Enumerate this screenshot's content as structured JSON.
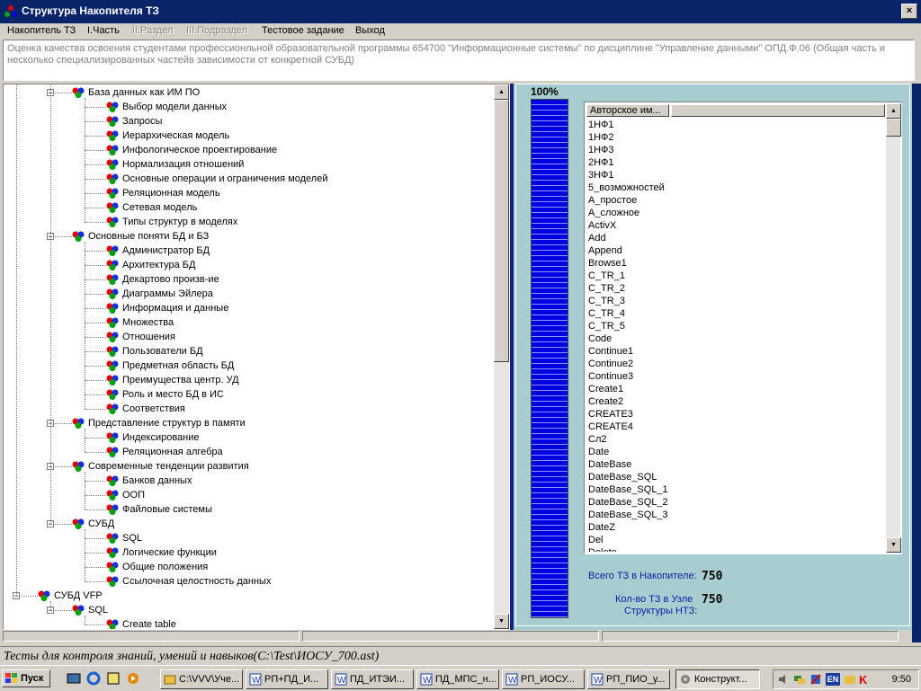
{
  "window": {
    "title": "Структура Накопителя ТЗ",
    "close_glyph": "×"
  },
  "menu": [
    {
      "label": "Накопитель ТЗ",
      "enabled": true
    },
    {
      "label": "I.Часть",
      "enabled": true
    },
    {
      "label": "II.Раздел",
      "enabled": false
    },
    {
      "label": "III.Подраздел",
      "enabled": false
    },
    {
      "label": "Тестовое задание",
      "enabled": true
    },
    {
      "label": "Выход",
      "enabled": true
    }
  ],
  "description": "Оценка качества освоения студентами профессионльной образовательной программы 654700 \"Информационные системы\" по дисциплине \"Управление данными\" ОПД.Ф.06 (Общая часть и несколько специализированных частейв зависимости от конкретной СУБД)",
  "tree": {
    "nodes": [
      {
        "level": 1,
        "label": "База данных как ИМ ПО",
        "expanded": true
      },
      {
        "level": 2,
        "label": "Выбор модели данных"
      },
      {
        "level": 2,
        "label": "Запросы"
      },
      {
        "level": 2,
        "label": "Иерархическая модель"
      },
      {
        "level": 2,
        "label": "Инфологическое проектирование"
      },
      {
        "level": 2,
        "label": "Нормализация отношений"
      },
      {
        "level": 2,
        "label": "Основные операции и ограничения моделей"
      },
      {
        "level": 2,
        "label": "Реляционная модель"
      },
      {
        "level": 2,
        "label": "Сетевая модель"
      },
      {
        "level": 2,
        "label": "Типы структур в моделях"
      },
      {
        "level": 1,
        "label": "Основные поняти БД и БЗ",
        "expanded": true
      },
      {
        "level": 2,
        "label": "Администратор БД"
      },
      {
        "level": 2,
        "label": "Архитектура БД"
      },
      {
        "level": 2,
        "label": "Декартово произв-ие"
      },
      {
        "level": 2,
        "label": "Диаграммы Эйлера"
      },
      {
        "level": 2,
        "label": "Информация и данные"
      },
      {
        "level": 2,
        "label": "Множества"
      },
      {
        "level": 2,
        "label": "Отношения"
      },
      {
        "level": 2,
        "label": "Пользователи БД"
      },
      {
        "level": 2,
        "label": "Предметная область БД"
      },
      {
        "level": 2,
        "label": "Преимущества центр. УД"
      },
      {
        "level": 2,
        "label": "Роль и место БД в ИС"
      },
      {
        "level": 2,
        "label": "Соответствия"
      },
      {
        "level": 1,
        "label": "Представление структур в памяти",
        "expanded": true
      },
      {
        "level": 2,
        "label": "Индексирование"
      },
      {
        "level": 2,
        "label": "Реляционная алгебра"
      },
      {
        "level": 1,
        "label": "Современные тенденции  развития",
        "expanded": true
      },
      {
        "level": 2,
        "label": "Банков данных"
      },
      {
        "level": 2,
        "label": "ООП"
      },
      {
        "level": 2,
        "label": "Файловые системы"
      },
      {
        "level": 1,
        "label": "СУБД",
        "expanded": true
      },
      {
        "level": 2,
        "label": "SQL"
      },
      {
        "level": 2,
        "label": "Логические функции"
      },
      {
        "level": 2,
        "label": "Общие положения"
      },
      {
        "level": 2,
        "label": "Ссылочная целостность данных"
      },
      {
        "level": 0,
        "label": "СУБД VFP",
        "expanded": true
      },
      {
        "level": 1,
        "label": "SQL",
        "expanded": true
      },
      {
        "level": 2,
        "label": "Create table"
      }
    ],
    "scroll_up_glyph": "▲",
    "scroll_down_glyph": "▼",
    "expander_glyph": "−"
  },
  "progress": {
    "percent_label": "100%",
    "fraction": 1.0,
    "color": "#0000e0"
  },
  "authors_list": {
    "header": "Авторское им...",
    "items": [
      "1НФ1",
      "1НФ2",
      "1НФ3",
      "2НФ1",
      "3НФ1",
      "5_возможностей",
      "А_простое",
      "А_сложное",
      "ActivX",
      "Add",
      "Append",
      "Browse1",
      "C_TR_1",
      "C_TR_2",
      "C_TR_3",
      "C_TR_4",
      "C_TR_5",
      "Code",
      "Continue1",
      "Continue2",
      "Continue3",
      "Create1",
      "Create2",
      "CREATE3",
      "CREATE4",
      "Cл2",
      "Date",
      "DateBase",
      "DateBase_SQL",
      "DateBase_SQL_1",
      "DateBase_SQL_2",
      "DateBase_SQL_3",
      "DateZ",
      "Del",
      "Delete"
    ],
    "scroll_up_glyph": "▲",
    "scroll_down_glyph": "▼"
  },
  "stats": {
    "total_label": "Всего ТЗ в Накопителе:",
    "total_value": "750",
    "node_label_1": "Кол-во ТЗ в Узле",
    "node_label_2": "Структуры НТЗ:",
    "node_value": "750"
  },
  "status_bar": "Тесты для контроля знаний, умений и навыков(C:\\Test\\ИОСУ_700.ast)",
  "taskbar": {
    "start_label": "Пуск",
    "tasks": [
      {
        "label": "C:\\VVV\\Уче...",
        "icon": "folder-icon"
      },
      {
        "label": "РП+ПД_И...",
        "icon": "word-icon"
      },
      {
        "label": "ПД_ИТЭИ...",
        "icon": "word-icon"
      },
      {
        "label": "ПД_МПС_н...",
        "icon": "word-icon"
      },
      {
        "label": "РП_ИОСУ...",
        "icon": "word-icon"
      },
      {
        "label": "РП_ПИО_у...",
        "icon": "word-icon"
      },
      {
        "label": "Конструкт...",
        "icon": "app-icon"
      }
    ],
    "tray_language": "EN",
    "clock": "9:50"
  },
  "colors": {
    "titlebar": "#0a246a",
    "panel_bg": "#a7cdd0",
    "stat_label": "#1020a0"
  }
}
